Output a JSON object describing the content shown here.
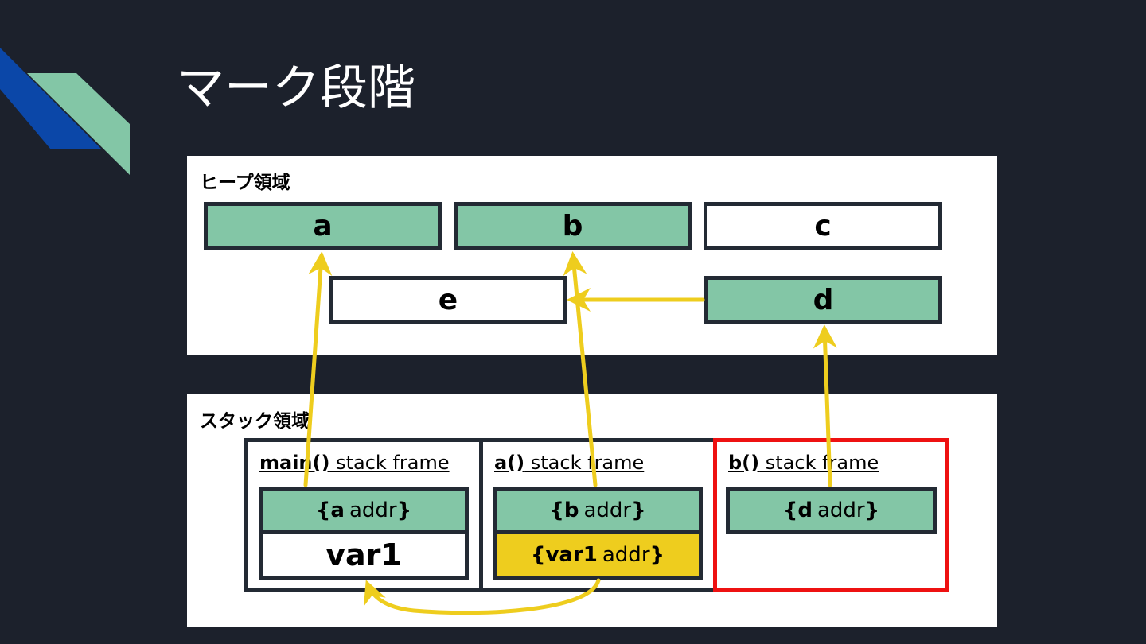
{
  "slide": {
    "title": "マーク段階"
  },
  "heap": {
    "label": "ヒープ領域",
    "objects": {
      "a": "a",
      "b": "b",
      "c": "c",
      "d": "d",
      "e": "e"
    }
  },
  "stack": {
    "label": "スタック領域",
    "frames": [
      {
        "name": "main()",
        "suffix": " stack frame",
        "cells": [
          {
            "bold": "a",
            "text": "addr"
          },
          {
            "text": "var1"
          }
        ]
      },
      {
        "name": "a()",
        "suffix": " stack frame",
        "cells": [
          {
            "bold": "b",
            "text": "addr"
          },
          {
            "bold": "var1",
            "text": "addr"
          }
        ]
      },
      {
        "name": "b()",
        "suffix": " stack frame",
        "cells": [
          {
            "bold": "d",
            "text": "addr"
          }
        ]
      }
    ]
  },
  "colors": {
    "marked": "#83c6a6",
    "unmarked": "#ffffff",
    "pointer_arrow": "#eecd1e",
    "current_frame": "#ee1111",
    "background": "#1c212c"
  }
}
